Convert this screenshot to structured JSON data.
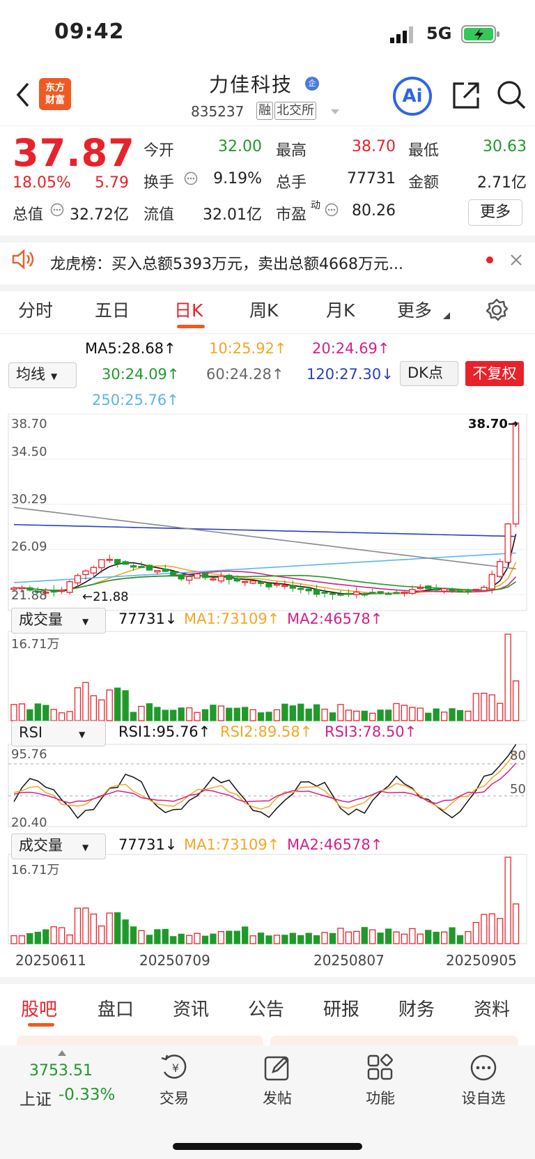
{
  "status": {
    "time": "09:42",
    "network": "5G"
  },
  "header": {
    "logo_line1": "东方",
    "logo_line2": "财富",
    "name": "力佳科技",
    "name_badge": "企",
    "code": "835237",
    "tag1": "融",
    "tag2": "北交所",
    "ai_label": "Ai"
  },
  "quote": {
    "price": "37.87",
    "pct": "18.05%",
    "change": "5.79",
    "open_label": "今开",
    "open": "32.00",
    "high_label": "最高",
    "high": "38.70",
    "low_label": "最低",
    "low": "30.63",
    "turnover_label": "换手",
    "turnover": "9.19%",
    "volume_label": "总手",
    "volume": "77731",
    "amount_label": "金额",
    "amount": "2.71亿",
    "mktcap_label": "总值",
    "mktcap": "32.72亿",
    "float_label": "流值",
    "float": "32.01亿",
    "pe_label": "市盈",
    "pe_sup": "动",
    "pe": "80.26",
    "more": "更多"
  },
  "notice": {
    "text": "龙虎榜：买入总额5393万元，卖出总额4668万元..."
  },
  "ktabs": [
    "分时",
    "五日",
    "日K",
    "周K",
    "月K",
    "更多"
  ],
  "ma": {
    "select": "均线",
    "ma5": "MA5:28.68↑",
    "ma10": "10:25.92↑",
    "ma20": "20:24.69↑",
    "ma30": "30:24.09↑",
    "ma60": "60:24.28↑",
    "ma120": "120:27.30↓",
    "ma250": "250:25.76↑",
    "dk": "DK点",
    "fq": "不复权"
  },
  "price_axis": {
    "t1": "38.70",
    "t2": "34.50",
    "t3": "30.29",
    "t4": "26.09",
    "t5": "21.88",
    "high_mark": "38.70→",
    "low_mark": "←21.88"
  },
  "vol1": {
    "select": "成交量",
    "v": "77731↓",
    "ma1": "MA1:73109↑",
    "ma2": "MA2:46578↑",
    "max": "16.71万"
  },
  "rsi": {
    "select": "RSI",
    "r1": "RSI1:95.76↑",
    "r2": "RSI2:89.58↑",
    "r3": "RSI3:78.50↑",
    "top": "95.76",
    "bottom": "20.40",
    "l80": "80",
    "l50": "50"
  },
  "vol2": {
    "select": "成交量",
    "v": "77731↓",
    "ma1": "MA1:73109↑",
    "ma2": "MA2:46578↑",
    "max": "16.71万"
  },
  "dates": [
    "20250611",
    "20250709",
    "20250807",
    "20250905"
  ],
  "bottom_tabs": [
    "股吧",
    "盘口",
    "资讯",
    "公告",
    "研报",
    "财务",
    "资料"
  ],
  "nav": {
    "index_value": "3753.51",
    "index_name": "上证",
    "index_pct": "-0.33%",
    "trade": "交易",
    "post": "发帖",
    "func": "功能",
    "watch": "设自选"
  },
  "chart_data": {
    "type": "candlestick",
    "ylim": [
      20.4,
      38.7
    ],
    "price_ticks": [
      38.7,
      34.5,
      30.29,
      26.09,
      21.88
    ],
    "dates": [
      "20250611",
      "20250709",
      "20250807",
      "20250905"
    ],
    "ma": {
      "MA5": 28.68,
      "MA10": 25.92,
      "MA20": 24.69,
      "MA30": 24.09,
      "MA60": 24.28,
      "MA120": 27.3,
      "MA250": 25.76
    },
    "last_close": 37.87,
    "volume_max": "16.71万",
    "rsi": {
      "RSI1": 95.76,
      "RSI2": 89.58,
      "RSI3": 78.5
    }
  }
}
